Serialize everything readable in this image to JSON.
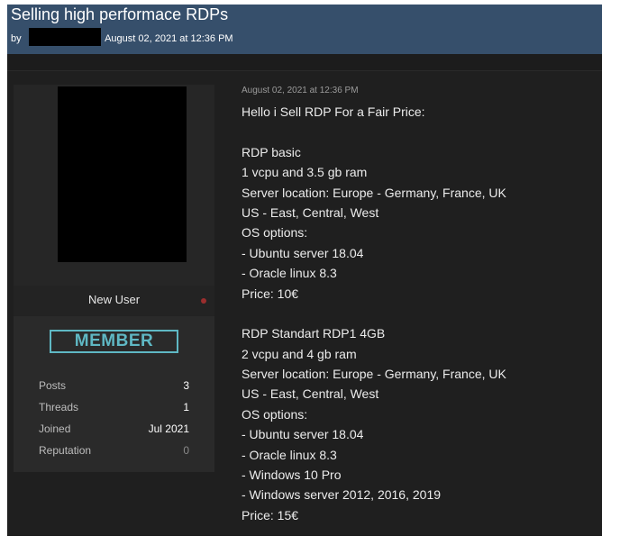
{
  "thread": {
    "title": "Selling high performace RDPs",
    "by_label": "by",
    "date": "August 02, 2021 at 12:36 PM"
  },
  "user": {
    "name": "New User",
    "rank_badge": "MEMBER",
    "stats": [
      {
        "label": "Posts",
        "value": "3"
      },
      {
        "label": "Threads",
        "value": "1"
      },
      {
        "label": "Joined",
        "value": "Jul 2021"
      },
      {
        "label": "Reputation",
        "value": "0"
      }
    ]
  },
  "post": {
    "date": "August 02, 2021 at 12:36 PM",
    "lines": [
      "Hello i Sell RDP For a Fair Price:",
      "",
      "RDP basic",
      "1 vcpu and 3.5 gb ram",
      "Server location: Europe - Germany, France, UK",
      "US - East, Central, West",
      "OS options:",
      "- Ubuntu server 18.04",
      "- Oracle linux 8.3",
      "Price: 10€",
      "",
      "RDP Standart RDP1 4GB",
      "2 vcpu and 4 gb ram",
      "Server location: Europe - Germany, France, UK",
      "US - East, Central, West",
      "OS options:",
      "- Ubuntu server 18.04",
      "- Oracle linux 8.3",
      "- Windows 10 Pro",
      "- Windows server 2012, 2016, 2019",
      "Price: 15€"
    ]
  },
  "colors": {
    "header_bg": "#364f6b",
    "page_bg": "#1f1f1f",
    "badge_accent": "#5fb8c4",
    "offline_dot": "#9a2e2e"
  }
}
